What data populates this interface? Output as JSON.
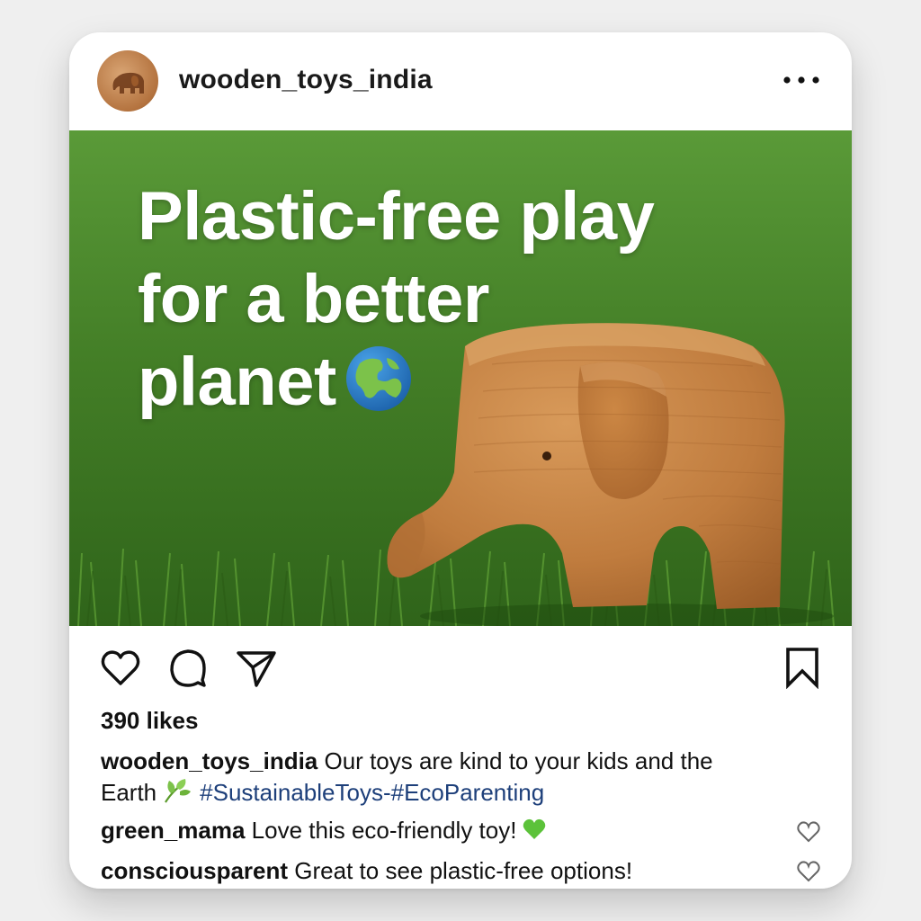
{
  "post": {
    "username": "wooden_toys_india",
    "more_icon": "more-dots-icon",
    "avatar_icon": "elephant-avatar-icon",
    "image": {
      "headline_line1": "Plastic-free play",
      "headline_line2": "for a better",
      "headline_line3": "planet",
      "headline_emoji": "globe-icon",
      "description": ""
    },
    "actions": {
      "like_icon": "heart-icon",
      "comment_icon": "comment-icon",
      "share_icon": "send-icon",
      "save_icon": "bookmark-icon"
    },
    "likes_text": "390 likes",
    "caption": {
      "username": "wooden_toys_india",
      "text_part1": "Our toys are kind to your kids and the",
      "text_part2": "Earth",
      "emoji": "leaf-icon",
      "hashtags": "#SustainableToys-#EcoParenting"
    },
    "comments": [
      {
        "username": "green_mama",
        "text": "Love this eco-friendly toy!",
        "emoji": "green-heart-icon"
      },
      {
        "username": "consciousparent",
        "text": "Great to see plastic-free options!"
      }
    ]
  },
  "colors": {
    "background": "#efefef",
    "card": "#ffffff",
    "grass": "#3f7d24",
    "hashtag": "#1d3f7a",
    "text": "#111111"
  }
}
